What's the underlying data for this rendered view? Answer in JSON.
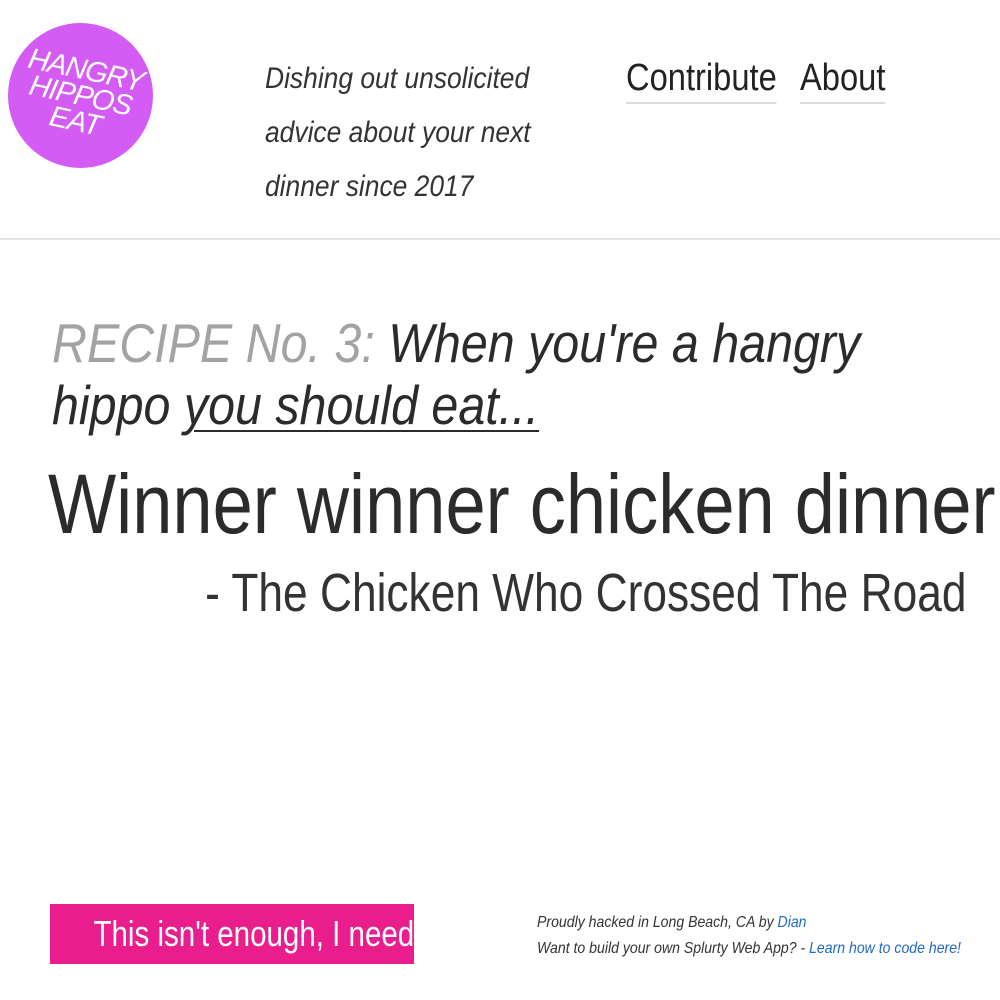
{
  "header": {
    "logo": {
      "lines": [
        "HANGRY",
        "HIPPOS",
        "EAT"
      ],
      "color": "#d55bf5"
    },
    "tagline": {
      "lines": [
        "Dishing out unsolicited",
        "advice about your next",
        "dinner since 2017"
      ]
    },
    "nav": {
      "contribute": "Contribute",
      "about": "About"
    }
  },
  "main": {
    "recipe_prefix": "RECIPE No. 3:",
    "recipe_lead": "When you're a hangry hippo",
    "recipe_underlined": "you should eat...",
    "dish": "Winner winner chicken dinner",
    "attribution": "- The Chicken Who Crossed The Road"
  },
  "footer": {
    "more_button": "This isn't enough, I need more",
    "more_button_color": "#e91e8c",
    "credit_text": "Proudly hacked in Long Beach, CA by",
    "credit_author": "Dian",
    "build_text": "Want to build your own Splurty Web App? -",
    "build_link": "Learn how to code here!",
    "link_color": "#1f68c9"
  }
}
